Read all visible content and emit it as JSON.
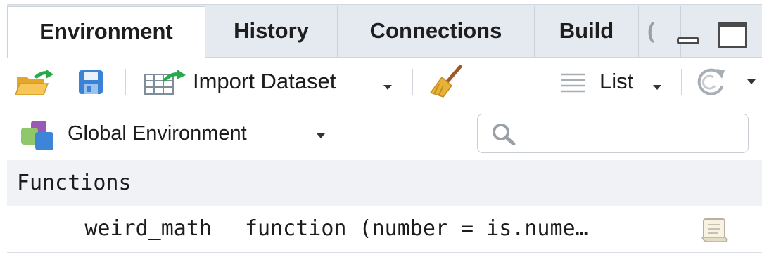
{
  "tabs": [
    {
      "label": "Environment",
      "active": true
    },
    {
      "label": "History",
      "active": false
    },
    {
      "label": "Connections",
      "active": false
    },
    {
      "label": "Build",
      "active": false
    },
    {
      "label": "(",
      "active": false
    }
  ],
  "toolbar": {
    "import_label": "Import Dataset",
    "list_label": "List",
    "icons": [
      "open-folder-icon",
      "save-icon",
      "import-dataset-icon",
      "broom-icon",
      "list-icon",
      "refresh-icon"
    ]
  },
  "env_bar": {
    "env_label": "Global Environment",
    "search_placeholder": ""
  },
  "objects": {
    "section_title": "Functions",
    "rows": [
      {
        "name": "weird_math",
        "value": "function (number = is.nume…"
      }
    ]
  },
  "colors": {
    "tab_bg": "#e5eaf0",
    "folder_yellow": "#f2b73d",
    "arrow_green": "#2aa84a",
    "save_blue": "#3a82d6"
  }
}
